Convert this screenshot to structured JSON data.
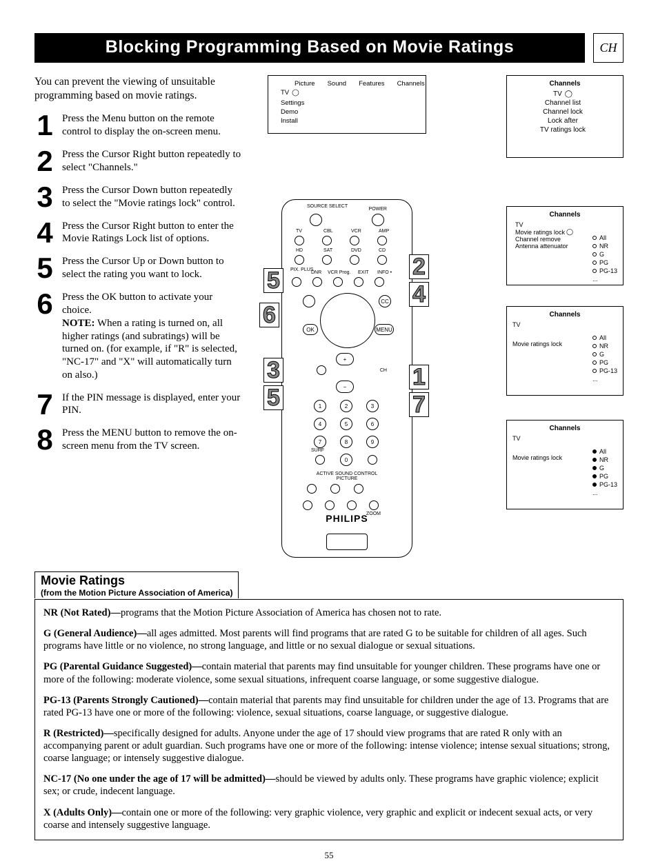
{
  "title": "Blocking Programming Based on Movie Ratings",
  "corner_label": "CH",
  "page_number": "55",
  "intro": "You can prevent the viewing of unsuitable programming based on movie ratings.",
  "steps": [
    {
      "n": "1",
      "text": "Press the Menu button on the remote control to display the on-screen menu."
    },
    {
      "n": "2",
      "text": "Press the Cursor Right button repeatedly to select \"Channels.\""
    },
    {
      "n": "3",
      "text": "Press the Cursor Down button repeatedly to select the \"Movie ratings lock\" control."
    },
    {
      "n": "4",
      "text": "Press the Cursor Right button to enter the Movie Ratings Lock list of options."
    },
    {
      "n": "5",
      "text": "Press the Cursor Up or Down button to select the rating you want to lock."
    },
    {
      "n": "6",
      "text": "Press the OK button to activate your choice.",
      "note": "NOTE:",
      "note_text": " When a rating is turned on, all higher ratings (and subratings) will be turned on. (for example, if \"R\" is selected, \"NC-17\" and \"X\" will automatically turn on also.)"
    },
    {
      "n": "7",
      "text": "If the PIN message is displayed, enter your PIN."
    },
    {
      "n": "8",
      "text": "Press the MENU button to remove the on-screen menu from the TV screen."
    }
  ],
  "menu_top": {
    "tabs": [
      "Picture",
      "Sound",
      "Features",
      "Channels"
    ],
    "tv_label": "TV",
    "left_items": [
      "Settings",
      "Demo",
      "Install"
    ]
  },
  "panel1": {
    "header": "Channels",
    "tv": "TV",
    "items": [
      "Channel list",
      "Channel lock",
      "Lock after",
      "TV ratings lock"
    ]
  },
  "panel2": {
    "header": "Channels",
    "tv": "TV",
    "left_items": [
      "Movie ratings lock",
      "Channel remove",
      "Antenna attenuator"
    ],
    "options": [
      "All",
      "NR",
      "G",
      "PG",
      "PG-13"
    ],
    "ellipsis": "..."
  },
  "panel3": {
    "header": "Channels",
    "tv": "TV",
    "label": "Movie ratings lock",
    "options": [
      "All",
      "NR",
      "G",
      "PG",
      "PG-13"
    ],
    "ellipsis": "..."
  },
  "panel4": {
    "header": "Channels",
    "tv": "TV",
    "label": "Movie ratings lock",
    "options": [
      "All",
      "NR",
      "G",
      "PG",
      "PG-13"
    ],
    "ellipsis": "..."
  },
  "remote": {
    "brand": "PHILIPS",
    "top_labels": {
      "source": "SOURCE\nSELECT",
      "power": "POWER",
      "tv": "TV",
      "cbl": "CBL",
      "vcr": "VCR",
      "amp": "AMP",
      "hd": "HD",
      "sat": "SAT",
      "dvd": "DVD",
      "cd": "CD"
    },
    "mid_labels": {
      "pixplus": "PIX.\nPLUS",
      "dnr": "DNR",
      "vcrprog": "VCR Prog.",
      "exit": "EXIT",
      "info": "INFO •"
    },
    "face": {
      "ok": "OK",
      "menu": "MENU",
      "ch": "CH",
      "cc": "CC",
      "mute": "mute-icon"
    },
    "numpad": [
      "1",
      "2",
      "3",
      "4",
      "5",
      "6",
      "7",
      "8",
      "9",
      "0"
    ],
    "surf": "SURF",
    "bottom_label": "ACTIVE\nSOUND CONTROL PICTURE",
    "zoom": "ZOOM"
  },
  "callouts": {
    "c1": "1",
    "c2": "2",
    "c3": "3",
    "c4": "4",
    "c5a": "5",
    "c5b": "5",
    "c6": "6",
    "c7": "7"
  },
  "ratings_header": {
    "title": "Movie Ratings",
    "subtitle": "(from the Motion Picture Association of America)"
  },
  "ratings": [
    {
      "name": "NR (Not Rated)—",
      "desc": "programs that the Motion Picture Association of America has chosen not to rate."
    },
    {
      "name": "G (General Audience)—",
      "desc": "all ages admitted. Most parents will find programs that are rated G to be suitable for children of all ages. Such programs have little or no violence, no strong language, and little or no sexual dialogue or sexual situations."
    },
    {
      "name": "PG (Parental Guidance Suggested)—",
      "desc": "contain material that parents may find unsuitable for younger children. These programs have one or more of the following: moderate violence, some sexual situations, infrequent coarse language, or some suggestive dialogue."
    },
    {
      "name": "PG-13 (Parents Strongly Cautioned)—",
      "desc": "contain material that parents may find unsuitable for children under the age of 13. Programs that are rated PG-13 have one or more of the following: violence, sexual situations, coarse language, or suggestive dialogue."
    },
    {
      "name": "R (Restricted)—",
      "desc": "specifically designed for adults. Anyone under the age of 17 should view programs that are rated R only with an accompanying parent or adult guardian. Such programs have one or more of the following: intense violence; intense sexual situations; strong, coarse language; or intensely suggestive dialogue."
    },
    {
      "name": "NC-17 (No one under the age of 17 will be admitted)—",
      "desc": "should be viewed by adults only. These programs have graphic violence; explicit sex; or crude, indecent language."
    },
    {
      "name": "X (Adults Only)—",
      "desc": "contain one or more of the following: very graphic violence, very graphic and explicit or indecent sexual acts, or very coarse and intensely suggestive language."
    }
  ]
}
